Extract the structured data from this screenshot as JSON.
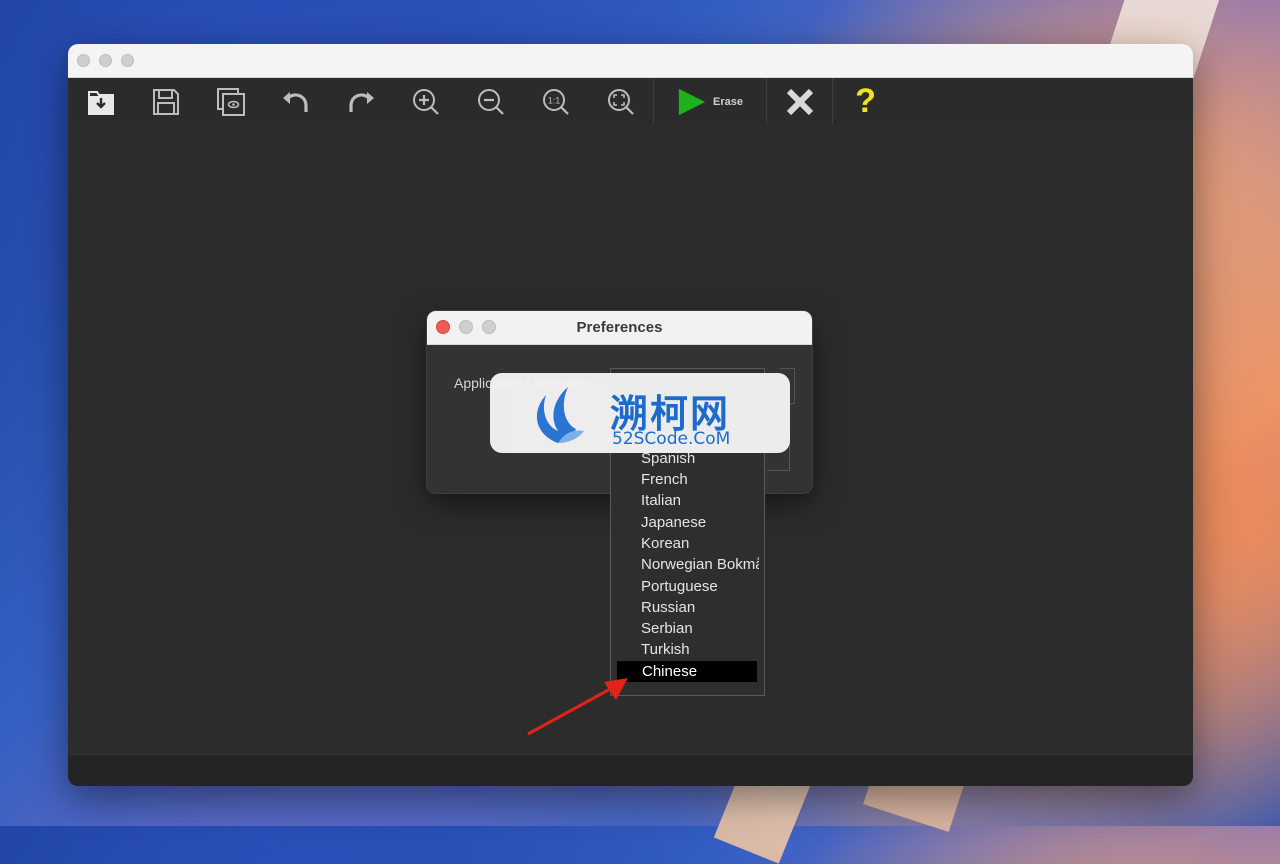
{
  "toolbar": {
    "buttons": [
      {
        "icon": "import-icon"
      },
      {
        "icon": "save-icon"
      },
      {
        "icon": "preview-icon"
      },
      {
        "icon": "undo-icon"
      },
      {
        "icon": "redo-icon"
      },
      {
        "icon": "zoom-in-icon"
      },
      {
        "icon": "zoom-out-icon"
      },
      {
        "icon": "actual-size-icon",
        "label": "1:1"
      },
      {
        "icon": "fit-to-window-icon"
      }
    ],
    "erase_label": "Erase",
    "help_label": "?",
    "colors": {
      "play": "#1db31d",
      "help": "#f2e21b",
      "cancel": "#d9d9d9"
    }
  },
  "preferences": {
    "title": "Preferences",
    "language_label": "Application Language"
  },
  "language_menu": {
    "items": [
      "Spanish",
      "French",
      "Italian",
      "Japanese",
      "Korean",
      "Norwegian Bokmål",
      "Portuguese",
      "Russian",
      "Serbian",
      "Turkish",
      "Chinese"
    ],
    "selected": "Chinese"
  },
  "watermark": {
    "title": "溯柯网",
    "subtitle": "52SCode.CoM"
  }
}
